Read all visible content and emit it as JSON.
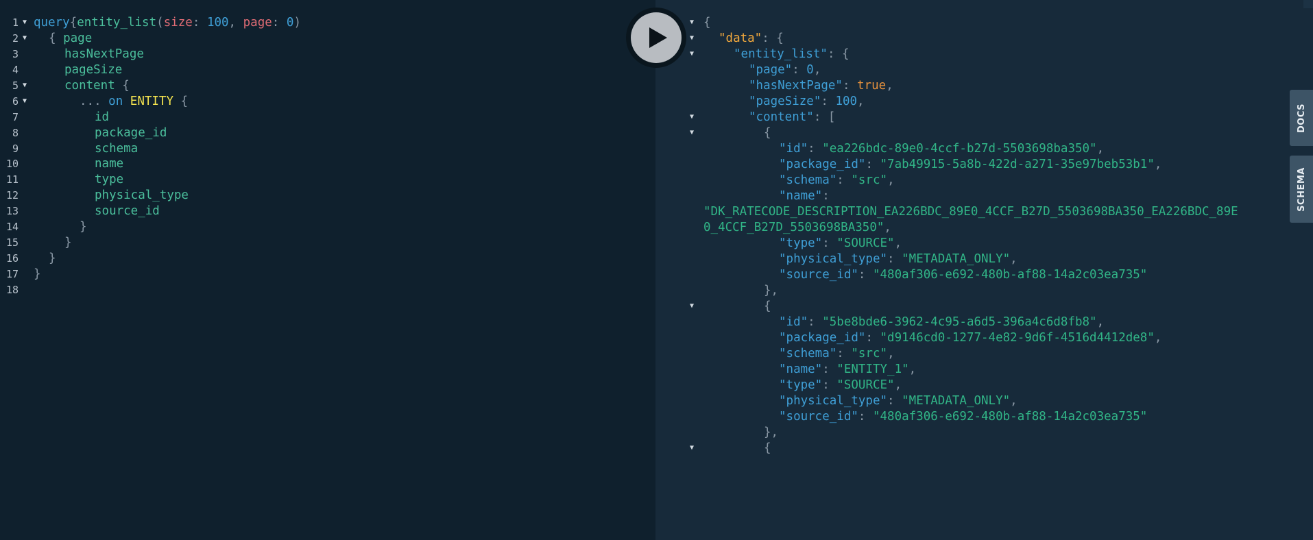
{
  "editor": {
    "line_numbers": [
      "1",
      "2",
      "3",
      "4",
      "5",
      "6",
      "7",
      "8",
      "9",
      "10",
      "11",
      "12",
      "13",
      "14",
      "15",
      "16",
      "17",
      "18"
    ],
    "query_keyword": "query",
    "operation": "entity_list",
    "arg_size_name": "size",
    "arg_size_value": "100",
    "arg_page_name": "page",
    "arg_page_value": "0",
    "open_paren": "(",
    "close_paren": ")",
    "colon": ":",
    "comma": ",",
    "open_brace": "{",
    "close_brace": "}",
    "fields": {
      "page": "page",
      "hasNextPage": "hasNextPage",
      "pageSize": "pageSize",
      "content": "content",
      "spread": "...",
      "on_keyword": "on",
      "type_condition": "ENTITY",
      "id": "id",
      "package_id": "package_id",
      "schema": "schema",
      "name": "name",
      "type": "type",
      "physical_type": "physical_type",
      "source_id": "source_id"
    }
  },
  "run_button": {
    "icon": "play-icon"
  },
  "result": {
    "lines": [
      [
        [
          "p",
          "{"
        ]
      ],
      [
        [
          "dk",
          "\"data\""
        ],
        [
          "p",
          ": {"
        ]
      ],
      [
        [
          "k",
          "\"entity_list\""
        ],
        [
          "p",
          ": {"
        ]
      ],
      [
        [
          "k",
          "\"page\""
        ],
        [
          "p",
          ": "
        ],
        [
          "n",
          "0"
        ],
        [
          "p",
          ","
        ]
      ],
      [
        [
          "k",
          "\"hasNextPage\""
        ],
        [
          "p",
          ": "
        ],
        [
          "b",
          "true"
        ],
        [
          "p",
          ","
        ]
      ],
      [
        [
          "k",
          "\"pageSize\""
        ],
        [
          "p",
          ": "
        ],
        [
          "n",
          "100"
        ],
        [
          "p",
          ","
        ]
      ],
      [
        [
          "k",
          "\"content\""
        ],
        [
          "p",
          ": ["
        ]
      ],
      [
        [
          "p",
          "{"
        ]
      ],
      [
        [
          "k",
          "\"id\""
        ],
        [
          "p",
          ": "
        ],
        [
          "s",
          "\"ea226bdc-89e0-4ccf-b27d-5503698ba350\""
        ],
        [
          "p",
          ","
        ]
      ],
      [
        [
          "k",
          "\"package_id\""
        ],
        [
          "p",
          ": "
        ],
        [
          "s",
          "\"7ab49915-5a8b-422d-a271-35e97beb53b1\""
        ],
        [
          "p",
          ","
        ]
      ],
      [
        [
          "k",
          "\"schema\""
        ],
        [
          "p",
          ": "
        ],
        [
          "s",
          "\"src\""
        ],
        [
          "p",
          ","
        ]
      ],
      [
        [
          "k",
          "\"name\""
        ],
        [
          "p",
          ":"
        ]
      ],
      [
        [
          "s",
          "\"DK_RATECODE_DESCRIPTION_EA226BDC_89E0_4CCF_B27D_5503698BA350_EA226BDC_89E"
        ]
      ],
      [
        [
          "s",
          "0_4CCF_B27D_5503698BA350\""
        ],
        [
          "p",
          ","
        ]
      ],
      [
        [
          "k",
          "\"type\""
        ],
        [
          "p",
          ": "
        ],
        [
          "s",
          "\"SOURCE\""
        ],
        [
          "p",
          ","
        ]
      ],
      [
        [
          "k",
          "\"physical_type\""
        ],
        [
          "p",
          ": "
        ],
        [
          "s",
          "\"METADATA_ONLY\""
        ],
        [
          "p",
          ","
        ]
      ],
      [
        [
          "k",
          "\"source_id\""
        ],
        [
          "p",
          ": "
        ],
        [
          "s",
          "\"480af306-e692-480b-af88-14a2c03ea735\""
        ]
      ],
      [
        [
          "p",
          "},"
        ]
      ],
      [
        [
          "p",
          "{"
        ]
      ],
      [
        [
          "k",
          "\"id\""
        ],
        [
          "p",
          ": "
        ],
        [
          "s",
          "\"5be8bde6-3962-4c95-a6d5-396a4c6d8fb8\""
        ],
        [
          "p",
          ","
        ]
      ],
      [
        [
          "k",
          "\"package_id\""
        ],
        [
          "p",
          ": "
        ],
        [
          "s",
          "\"d9146cd0-1277-4e82-9d6f-4516d4412de8\""
        ],
        [
          "p",
          ","
        ]
      ],
      [
        [
          "k",
          "\"schema\""
        ],
        [
          "p",
          ": "
        ],
        [
          "s",
          "\"src\""
        ],
        [
          "p",
          ","
        ]
      ],
      [
        [
          "k",
          "\"name\""
        ],
        [
          "p",
          ": "
        ],
        [
          "s",
          "\"ENTITY_1\""
        ],
        [
          "p",
          ","
        ]
      ],
      [
        [
          "k",
          "\"type\""
        ],
        [
          "p",
          ": "
        ],
        [
          "s",
          "\"SOURCE\""
        ],
        [
          "p",
          ","
        ]
      ],
      [
        [
          "k",
          "\"physical_type\""
        ],
        [
          "p",
          ": "
        ],
        [
          "s",
          "\"METADATA_ONLY\""
        ],
        [
          "p",
          ","
        ]
      ],
      [
        [
          "k",
          "\"source_id\""
        ],
        [
          "p",
          ": "
        ],
        [
          "s",
          "\"480af306-e692-480b-af88-14a2c03ea735\""
        ]
      ],
      [
        [
          "p",
          "},"
        ]
      ],
      [
        [
          "p",
          "{"
        ]
      ]
    ]
  },
  "side_tabs": {
    "docs": "DOCS",
    "schema": "SCHEMA"
  },
  "colors": {
    "editor_bg": "#0f202d",
    "result_bg": "#172a3a",
    "keyword": "#3f9fd6",
    "field": "#4bbf9c",
    "argument": "#e06c75",
    "type": "#f5e44f",
    "data_key": "#f3a93d",
    "string": "#31b587",
    "boolean": "#e8923d"
  }
}
